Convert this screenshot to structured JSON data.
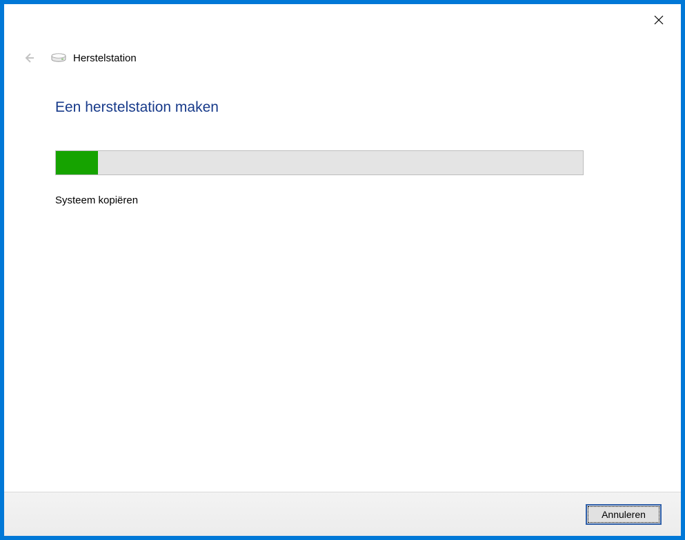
{
  "window": {
    "app_title": "Herstelstation",
    "heading": "Een herstelstation maken",
    "status_text": "Systeem kopiëren",
    "progress_percent": 8
  },
  "footer": {
    "cancel_label": "Annuleren"
  }
}
